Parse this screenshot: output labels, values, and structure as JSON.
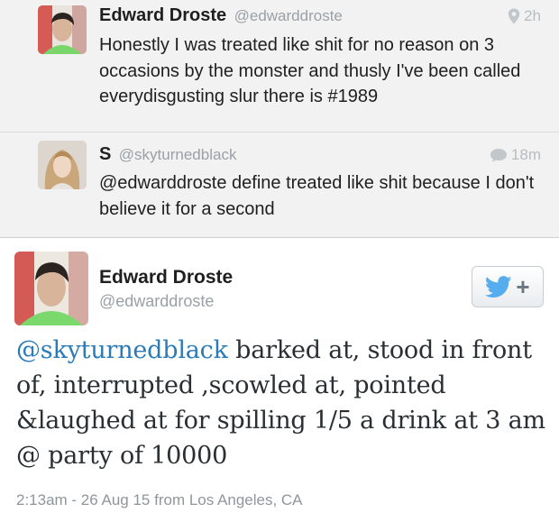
{
  "replies": [
    {
      "name": "Edward Droste",
      "handle": "@edwarddroste",
      "time": "2h",
      "meta_icon": "location-pin-icon",
      "text": "Honestly I was treated like shit for no reason on 3 occasions by the monster and thusly I've been called everydisgusting slur there is #1989"
    },
    {
      "name": "S",
      "handle": "@skyturnedblack",
      "time": "18m",
      "meta_icon": "reply-bubble-icon",
      "text": "@edwarddroste define treated like shit because I don't believe it for a second"
    }
  ],
  "main_tweet": {
    "name": "Edward Droste",
    "handle": "@edwarddroste",
    "mention": "@skyturnedblack",
    "text_rest": " barked at, stood in front of, interrupted ,scowled at, pointed &laughed at for spilling 1/5 a drink at 3 am @ party of 10000",
    "footer": "2:13am - 26 Aug 15 from Los Angeles, CA",
    "follow_button_icons": [
      "twitter-bird-icon",
      "plus-icon"
    ]
  },
  "colors": {
    "link": "#2b7bb9",
    "twitter_blue": "#55acee",
    "muted": "#9aa0a5"
  }
}
